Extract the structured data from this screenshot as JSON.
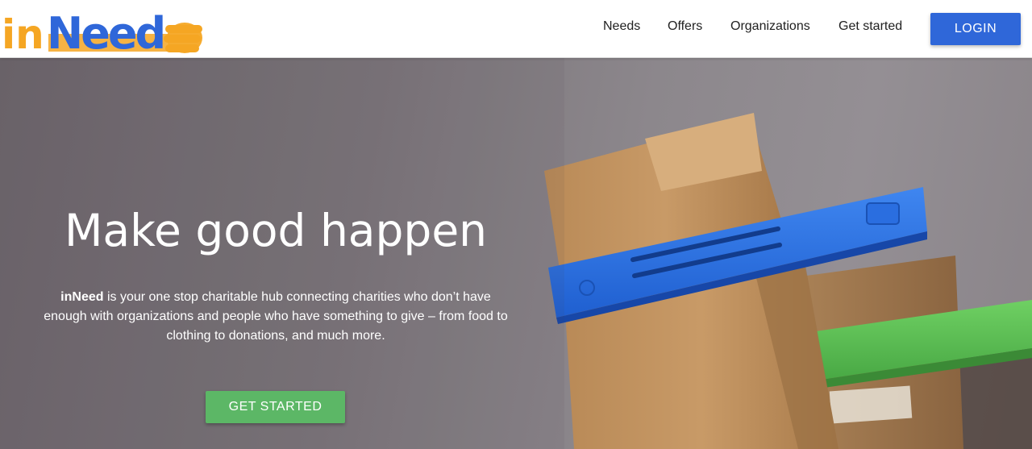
{
  "brand": {
    "logo_text": "inNeed",
    "colors": {
      "orange": "#f5a623",
      "blue": "#2f67d9",
      "green": "#5cb766"
    }
  },
  "nav": {
    "items": [
      {
        "label": "Needs"
      },
      {
        "label": "Offers"
      },
      {
        "label": "Organizations"
      },
      {
        "label": "Get started"
      }
    ],
    "login_label": "LOGIN"
  },
  "hero": {
    "title": "Make good happen",
    "description_brand": "inNeed",
    "description_rest": " is your one stop charitable hub connecting charities who don’t have enough with organizations and people who have something to give – from food to clothing to donations, and much more.",
    "cta_label": "GET STARTED",
    "background_image": "paper bags with blue and green bag clips"
  }
}
